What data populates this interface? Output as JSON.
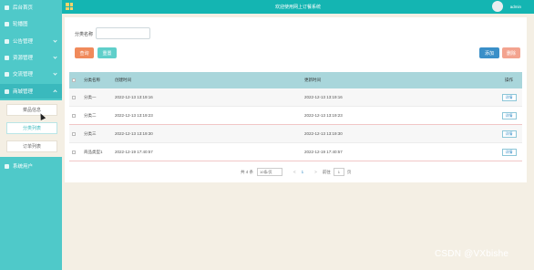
{
  "app": {
    "title": "欢迎使用网上订餐系统",
    "user": "admin"
  },
  "sidebar": {
    "items": [
      {
        "label": "后台首页"
      },
      {
        "label": "轮播图"
      },
      {
        "label": "公告管理"
      },
      {
        "label": "资源管理"
      },
      {
        "label": "交流管理"
      },
      {
        "label": "商城管理"
      }
    ],
    "submenu": [
      {
        "label": "菜品信息"
      },
      {
        "label": "分类列表"
      },
      {
        "label": "订单列表"
      }
    ],
    "bottom_item": {
      "label": "系统用户"
    }
  },
  "filter": {
    "category_label": "分类名称",
    "category_value": ""
  },
  "buttons": {
    "query": "查询",
    "reset": "重置",
    "add": "添加",
    "delete": "删除"
  },
  "table": {
    "headers": [
      "分类名称",
      "创建时间",
      "更新时间",
      "操作"
    ],
    "rows": [
      {
        "name": "分类一",
        "created": "2022-12-13 13:19:16",
        "updated": "2022-12-13 13:19:16",
        "action": "详情"
      },
      {
        "name": "分类二",
        "created": "2022-12-13 13:19:23",
        "updated": "2022-12-13 13:19:23",
        "action": "详情"
      },
      {
        "name": "分类三",
        "created": "2022-12-13 13:19:30",
        "updated": "2022-12-13 13:19:30",
        "action": "详情"
      },
      {
        "name": "商品类型1",
        "created": "2022-12-19 17:40:57",
        "updated": "2022-12-19 17:40:57",
        "action": "详情"
      }
    ]
  },
  "pagination": {
    "total": "共 4 条",
    "page_size": "10条/页",
    "prev": "<",
    "current": "1",
    "next": ">",
    "goto_label": "前往",
    "goto_value": "1",
    "page_suffix": "页"
  },
  "watermark": "CSDN @VXbishe"
}
